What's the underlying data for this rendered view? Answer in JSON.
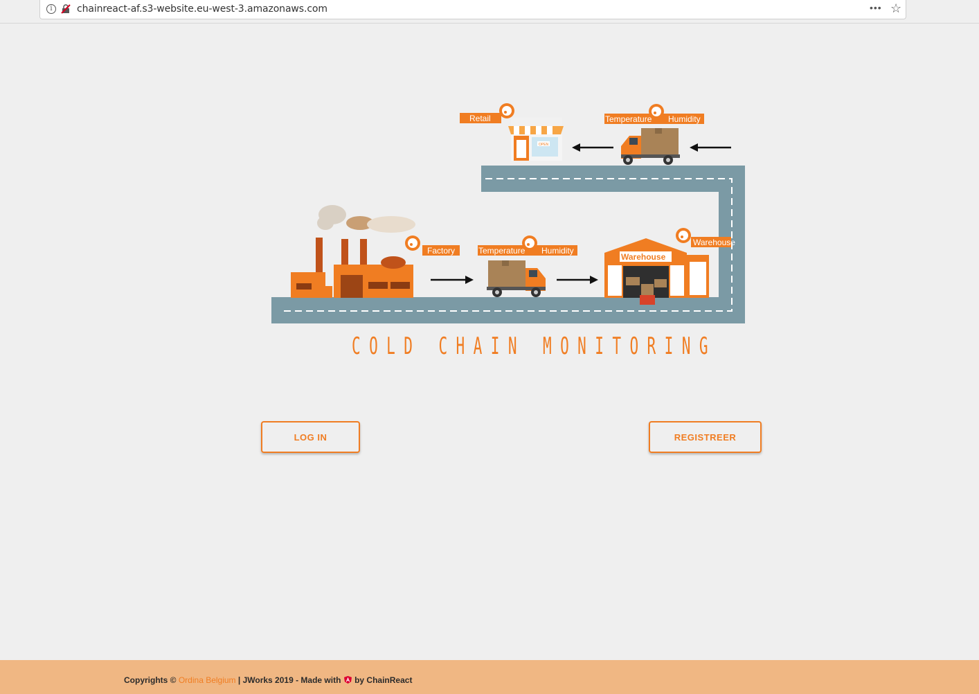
{
  "browser": {
    "url": "chainreact-af.s3-website.eu-west-3.amazonaws.com",
    "icons": [
      "info-icon",
      "insecure-lock-icon",
      "more-icon",
      "bookmark-star-icon"
    ]
  },
  "illustration": {
    "labels": {
      "retail": "Retail",
      "factory": "Factory",
      "warehouse_tag": "Warehouse",
      "warehouse_sign": "Warehouse",
      "temperature_top": "Temperature",
      "humidity_top": "Humidity",
      "temperature_bottom": "Temperature",
      "humidity_bottom": "Humidity",
      "shop_sign": "OPEN"
    },
    "colors": {
      "accent": "#f07d22",
      "road": "#7b9aa5",
      "box": "#a98357"
    }
  },
  "title": "COLD CHAIN MONITORING",
  "buttons": {
    "login": "LOG IN",
    "register": "REGISTREER"
  },
  "footer": {
    "prefix": "Copyrights © ",
    "company": "Ordina Belgium",
    "middle": " | JWorks 2019 - Made with ",
    "suffix": " by ChainReact"
  }
}
